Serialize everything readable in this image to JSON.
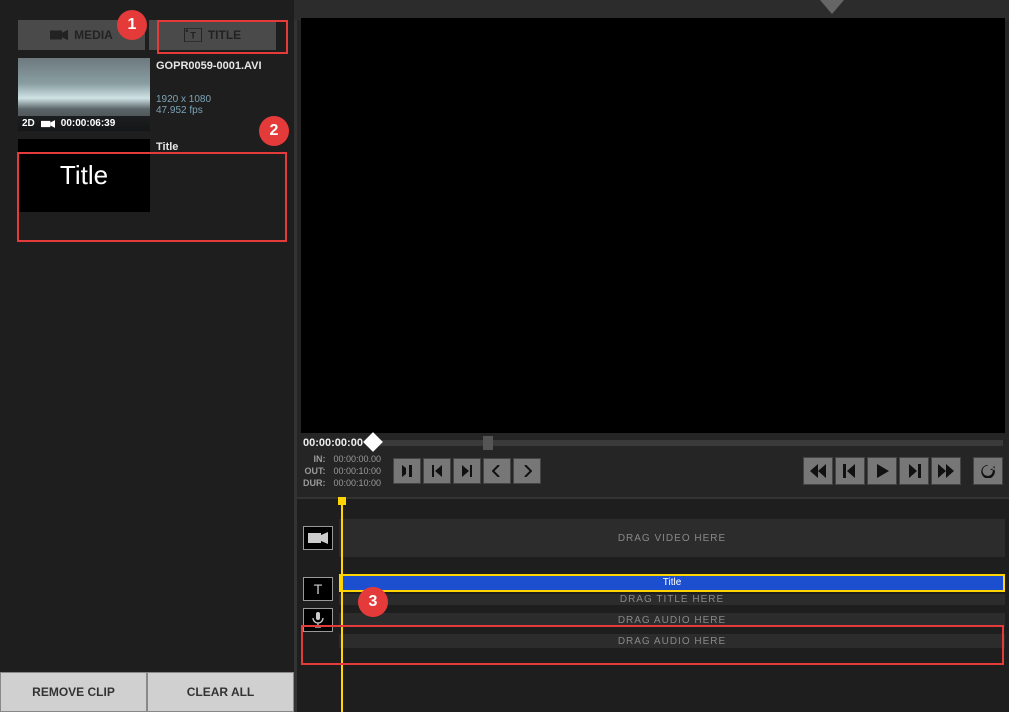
{
  "tabs": {
    "media": "MEDIA",
    "title": "TITLE"
  },
  "clip1": {
    "filename": "GOPR0059-0001.AVI",
    "resolution": "1920 x 1080",
    "fps": "47.952 fps",
    "badge3d": "2D",
    "duration": "00:00:06:39"
  },
  "clip2": {
    "thumb_label": "Title",
    "name": "Title"
  },
  "buttons": {
    "remove": "REMOVE CLIP",
    "clear": "CLEAR ALL"
  },
  "transport": {
    "current": "00:00:00:00",
    "in_label": "IN:",
    "in": "00:00:00.00",
    "out_label": "OUT:",
    "out": "00:00:10:00",
    "dur_label": "DUR:",
    "dur": "00:00:10:00"
  },
  "timeline": {
    "video_hint": "DRAG VIDEO HERE",
    "title_clip": "Title",
    "title_hint": "DRAG TITLE HERE",
    "audio_hint": "DRAG AUDIO HERE"
  },
  "annotations": {
    "1": "1",
    "2": "2",
    "3": "3"
  }
}
